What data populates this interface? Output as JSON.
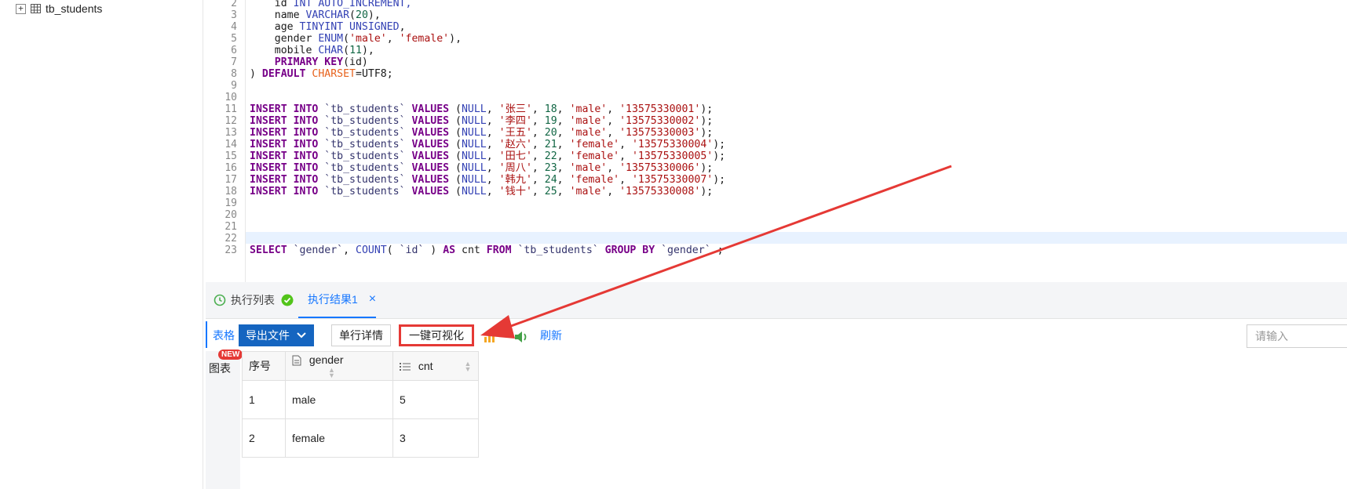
{
  "sidebar": {
    "table_item": "tb_students"
  },
  "editor": {
    "lines": [
      {
        "n": "2",
        "tokens": [
          {
            "t": "    id ",
            "c": ""
          },
          {
            "t": "INT",
            "c": "ty"
          },
          {
            "t": " AUTO_INCREMENT,",
            "c": "ty"
          }
        ]
      },
      {
        "n": "3",
        "tokens": [
          {
            "t": "    name ",
            "c": ""
          },
          {
            "t": "VARCHAR",
            "c": "ty"
          },
          {
            "t": "(",
            "c": ""
          },
          {
            "t": "20",
            "c": "nm"
          },
          {
            "t": "),",
            "c": ""
          }
        ]
      },
      {
        "n": "4",
        "tokens": [
          {
            "t": "    age ",
            "c": ""
          },
          {
            "t": "TINYINT UNSIGNED",
            "c": "ty"
          },
          {
            "t": ",",
            "c": ""
          }
        ]
      },
      {
        "n": "5",
        "tokens": [
          {
            "t": "    gender ",
            "c": ""
          },
          {
            "t": "ENUM",
            "c": "ty"
          },
          {
            "t": "(",
            "c": ""
          },
          {
            "t": "'male'",
            "c": "st"
          },
          {
            "t": ", ",
            "c": ""
          },
          {
            "t": "'female'",
            "c": "st"
          },
          {
            "t": "),",
            "c": ""
          }
        ]
      },
      {
        "n": "6",
        "tokens": [
          {
            "t": "    mobile ",
            "c": ""
          },
          {
            "t": "CHAR",
            "c": "ty"
          },
          {
            "t": "(",
            "c": ""
          },
          {
            "t": "11",
            "c": "nm"
          },
          {
            "t": "),",
            "c": ""
          }
        ]
      },
      {
        "n": "7",
        "tokens": [
          {
            "t": "    ",
            "c": ""
          },
          {
            "t": "PRIMARY KEY",
            "c": "kw"
          },
          {
            "t": "(id)",
            "c": ""
          }
        ]
      },
      {
        "n": "8",
        "tokens": [
          {
            "t": ") ",
            "c": ""
          },
          {
            "t": "DEFAULT",
            "c": "kw"
          },
          {
            "t": " ",
            "c": ""
          },
          {
            "t": "CHARSET",
            "c": "or"
          },
          {
            "t": "=UTF8;",
            "c": ""
          }
        ]
      },
      {
        "n": "9",
        "tokens": []
      },
      {
        "n": "10",
        "tokens": []
      },
      {
        "n": "11",
        "tokens": [
          {
            "t": "INSERT INTO",
            "c": "kw"
          },
          {
            "t": " `tb_students` ",
            "c": "bt"
          },
          {
            "t": "VALUES",
            "c": "kw"
          },
          {
            "t": " (",
            "c": ""
          },
          {
            "t": "NULL",
            "c": "ty"
          },
          {
            "t": ", ",
            "c": ""
          },
          {
            "t": "'张三'",
            "c": "st"
          },
          {
            "t": ", ",
            "c": ""
          },
          {
            "t": "18",
            "c": "nm"
          },
          {
            "t": ", ",
            "c": ""
          },
          {
            "t": "'male'",
            "c": "st"
          },
          {
            "t": ", ",
            "c": ""
          },
          {
            "t": "'13575330001'",
            "c": "st"
          },
          {
            "t": ");",
            "c": ""
          }
        ]
      },
      {
        "n": "12",
        "tokens": [
          {
            "t": "INSERT INTO",
            "c": "kw"
          },
          {
            "t": " `tb_students` ",
            "c": "bt"
          },
          {
            "t": "VALUES",
            "c": "kw"
          },
          {
            "t": " (",
            "c": ""
          },
          {
            "t": "NULL",
            "c": "ty"
          },
          {
            "t": ", ",
            "c": ""
          },
          {
            "t": "'李四'",
            "c": "st"
          },
          {
            "t": ", ",
            "c": ""
          },
          {
            "t": "19",
            "c": "nm"
          },
          {
            "t": ", ",
            "c": ""
          },
          {
            "t": "'male'",
            "c": "st"
          },
          {
            "t": ", ",
            "c": ""
          },
          {
            "t": "'13575330002'",
            "c": "st"
          },
          {
            "t": ");",
            "c": ""
          }
        ]
      },
      {
        "n": "13",
        "tokens": [
          {
            "t": "INSERT INTO",
            "c": "kw"
          },
          {
            "t": " `tb_students` ",
            "c": "bt"
          },
          {
            "t": "VALUES",
            "c": "kw"
          },
          {
            "t": " (",
            "c": ""
          },
          {
            "t": "NULL",
            "c": "ty"
          },
          {
            "t": ", ",
            "c": ""
          },
          {
            "t": "'王五'",
            "c": "st"
          },
          {
            "t": ", ",
            "c": ""
          },
          {
            "t": "20",
            "c": "nm"
          },
          {
            "t": ", ",
            "c": ""
          },
          {
            "t": "'male'",
            "c": "st"
          },
          {
            "t": ", ",
            "c": ""
          },
          {
            "t": "'13575330003'",
            "c": "st"
          },
          {
            "t": ");",
            "c": ""
          }
        ]
      },
      {
        "n": "14",
        "tokens": [
          {
            "t": "INSERT INTO",
            "c": "kw"
          },
          {
            "t": " `tb_students` ",
            "c": "bt"
          },
          {
            "t": "VALUES",
            "c": "kw"
          },
          {
            "t": " (",
            "c": ""
          },
          {
            "t": "NULL",
            "c": "ty"
          },
          {
            "t": ", ",
            "c": ""
          },
          {
            "t": "'赵六'",
            "c": "st"
          },
          {
            "t": ", ",
            "c": ""
          },
          {
            "t": "21",
            "c": "nm"
          },
          {
            "t": ", ",
            "c": ""
          },
          {
            "t": "'female'",
            "c": "st"
          },
          {
            "t": ", ",
            "c": ""
          },
          {
            "t": "'13575330004'",
            "c": "st"
          },
          {
            "t": ");",
            "c": ""
          }
        ]
      },
      {
        "n": "15",
        "tokens": [
          {
            "t": "INSERT INTO",
            "c": "kw"
          },
          {
            "t": " `tb_students` ",
            "c": "bt"
          },
          {
            "t": "VALUES",
            "c": "kw"
          },
          {
            "t": " (",
            "c": ""
          },
          {
            "t": "NULL",
            "c": "ty"
          },
          {
            "t": ", ",
            "c": ""
          },
          {
            "t": "'田七'",
            "c": "st"
          },
          {
            "t": ", ",
            "c": ""
          },
          {
            "t": "22",
            "c": "nm"
          },
          {
            "t": ", ",
            "c": ""
          },
          {
            "t": "'female'",
            "c": "st"
          },
          {
            "t": ", ",
            "c": ""
          },
          {
            "t": "'13575330005'",
            "c": "st"
          },
          {
            "t": ");",
            "c": ""
          }
        ]
      },
      {
        "n": "16",
        "tokens": [
          {
            "t": "INSERT INTO",
            "c": "kw"
          },
          {
            "t": " `tb_students` ",
            "c": "bt"
          },
          {
            "t": "VALUES",
            "c": "kw"
          },
          {
            "t": " (",
            "c": ""
          },
          {
            "t": "NULL",
            "c": "ty"
          },
          {
            "t": ", ",
            "c": ""
          },
          {
            "t": "'周八'",
            "c": "st"
          },
          {
            "t": ", ",
            "c": ""
          },
          {
            "t": "23",
            "c": "nm"
          },
          {
            "t": ", ",
            "c": ""
          },
          {
            "t": "'male'",
            "c": "st"
          },
          {
            "t": ", ",
            "c": ""
          },
          {
            "t": "'13575330006'",
            "c": "st"
          },
          {
            "t": ");",
            "c": ""
          }
        ]
      },
      {
        "n": "17",
        "tokens": [
          {
            "t": "INSERT INTO",
            "c": "kw"
          },
          {
            "t": " `tb_students` ",
            "c": "bt"
          },
          {
            "t": "VALUES",
            "c": "kw"
          },
          {
            "t": " (",
            "c": ""
          },
          {
            "t": "NULL",
            "c": "ty"
          },
          {
            "t": ", ",
            "c": ""
          },
          {
            "t": "'韩九'",
            "c": "st"
          },
          {
            "t": ", ",
            "c": ""
          },
          {
            "t": "24",
            "c": "nm"
          },
          {
            "t": ", ",
            "c": ""
          },
          {
            "t": "'female'",
            "c": "st"
          },
          {
            "t": ", ",
            "c": ""
          },
          {
            "t": "'13575330007'",
            "c": "st"
          },
          {
            "t": ");",
            "c": ""
          }
        ]
      },
      {
        "n": "18",
        "tokens": [
          {
            "t": "INSERT INTO",
            "c": "kw"
          },
          {
            "t": " `tb_students` ",
            "c": "bt"
          },
          {
            "t": "VALUES",
            "c": "kw"
          },
          {
            "t": " (",
            "c": ""
          },
          {
            "t": "NULL",
            "c": "ty"
          },
          {
            "t": ", ",
            "c": ""
          },
          {
            "t": "'钱十'",
            "c": "st"
          },
          {
            "t": ", ",
            "c": ""
          },
          {
            "t": "25",
            "c": "nm"
          },
          {
            "t": ", ",
            "c": ""
          },
          {
            "t": "'male'",
            "c": "st"
          },
          {
            "t": ", ",
            "c": ""
          },
          {
            "t": "'13575330008'",
            "c": "st"
          },
          {
            "t": ");",
            "c": ""
          }
        ]
      },
      {
        "n": "19",
        "tokens": []
      },
      {
        "n": "20",
        "tokens": []
      },
      {
        "n": "21",
        "tokens": []
      },
      {
        "n": "22",
        "tokens": []
      },
      {
        "n": "23",
        "tokens": [
          {
            "t": "SELECT",
            "c": "kw"
          },
          {
            "t": " `gender`",
            "c": "bt"
          },
          {
            "t": ", ",
            "c": ""
          },
          {
            "t": "COUNT",
            "c": "ty"
          },
          {
            "t": "( ",
            "c": ""
          },
          {
            "t": "`id`",
            "c": "bt"
          },
          {
            "t": " ) ",
            "c": ""
          },
          {
            "t": "AS",
            "c": "kw"
          },
          {
            "t": " cnt ",
            "c": ""
          },
          {
            "t": "FROM",
            "c": "kw"
          },
          {
            "t": " `tb_students` ",
            "c": "bt"
          },
          {
            "t": "GROUP BY",
            "c": "kw"
          },
          {
            "t": " `gender`",
            "c": "bt"
          },
          {
            "t": " ;",
            "c": ""
          }
        ]
      }
    ]
  },
  "panel": {
    "tab_exec_list": "执行列表",
    "tab_result": "执行结果1",
    "close_glyph": "×"
  },
  "toolbar": {
    "table_label": "表格",
    "export_label": "导出文件",
    "single_row_label": "单行详情",
    "visualize_label": "一键可视化",
    "refresh_label": "刷新",
    "search_placeholder": "请输入"
  },
  "side_tabs": {
    "chart_label": "图表",
    "new_badge": "NEW"
  },
  "result": {
    "headers": [
      "序号",
      "gender",
      "cnt"
    ],
    "rows": [
      [
        "1",
        "male",
        "5"
      ],
      [
        "2",
        "female",
        "3"
      ]
    ]
  },
  "colors": {
    "accent": "#1677ff",
    "primary_button": "#1565c0",
    "highlight": "#e53935",
    "success": "#52c41a"
  }
}
